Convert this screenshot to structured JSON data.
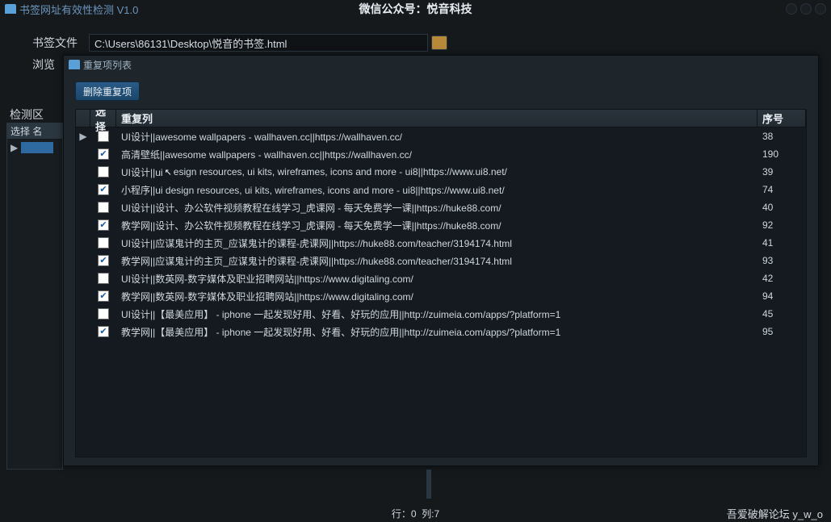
{
  "main": {
    "title": "书签网址有效性检测 V1.0",
    "center_title": "微信公众号：悦音科技",
    "bookmark_label": "书签文件",
    "bookmark_value": "C:\\Users\\86131\\Desktop\\悦音的书签.html",
    "browse_label": "浏览",
    "detect_label": "检测区",
    "grid_header": "选择  名"
  },
  "dialog": {
    "title": "重复项列表",
    "delete_button": "删除重复项",
    "columns": {
      "select": "选择",
      "duplicate": "重复列",
      "seq": "序号"
    },
    "rows": [
      {
        "arrow": true,
        "checked": false,
        "dup": "UI设计||awesome wallpapers - wallhaven.cc||https://wallhaven.cc/",
        "seq": "38"
      },
      {
        "arrow": false,
        "checked": true,
        "dup": "高清壁纸||awesome wallpapers - wallhaven.cc||https://wallhaven.cc/",
        "seq": "190"
      },
      {
        "arrow": false,
        "checked": false,
        "cursor": true,
        "dup_pre": "UI设计||ui ",
        "dup_post": "esign resources, ui kits, wireframes, icons and more - ui8||https://www.ui8.net/",
        "seq": "39"
      },
      {
        "arrow": false,
        "checked": true,
        "dup": "小程序||ui design resources, ui kits, wireframes, icons and more - ui8||https://www.ui8.net/",
        "seq": "74"
      },
      {
        "arrow": false,
        "checked": false,
        "dup": "UI设计||设计、办公软件视频教程在线学习_虎课网 - 每天免费学一课||https://huke88.com/",
        "seq": "40"
      },
      {
        "arrow": false,
        "checked": true,
        "dup": "教学网||设计、办公软件视频教程在线学习_虎课网 - 每天免费学一课||https://huke88.com/",
        "seq": "92"
      },
      {
        "arrow": false,
        "checked": false,
        "dup": "UI设计||应谋鬼计的主页_应谋鬼计的课程-虎课网||https://huke88.com/teacher/3194174.html",
        "seq": "41"
      },
      {
        "arrow": false,
        "checked": true,
        "dup": "教学网||应谋鬼计的主页_应谋鬼计的课程-虎课网||https://huke88.com/teacher/3194174.html",
        "seq": "93"
      },
      {
        "arrow": false,
        "checked": false,
        "dup": "UI设计||数英网-数字媒体及职业招聘网站||https://www.digitaling.com/",
        "seq": "42"
      },
      {
        "arrow": false,
        "checked": true,
        "dup": "教学网||数英网-数字媒体及职业招聘网站||https://www.digitaling.com/",
        "seq": "94"
      },
      {
        "arrow": false,
        "checked": false,
        "dup": "UI设计||【最美应用】 - iphone 一起发现好用、好看、好玩的应用||http://zuimeia.com/apps/?platform=1",
        "seq": "45"
      },
      {
        "arrow": false,
        "checked": true,
        "dup": "教学网||【最美应用】 - iphone 一起发现好用、好看、好玩的应用||http://zuimeia.com/apps/?platform=1",
        "seq": "95"
      }
    ]
  },
  "status": {
    "row": "行：0",
    "col": "列:7",
    "right": "吾爱破解论坛   y_w_o"
  }
}
